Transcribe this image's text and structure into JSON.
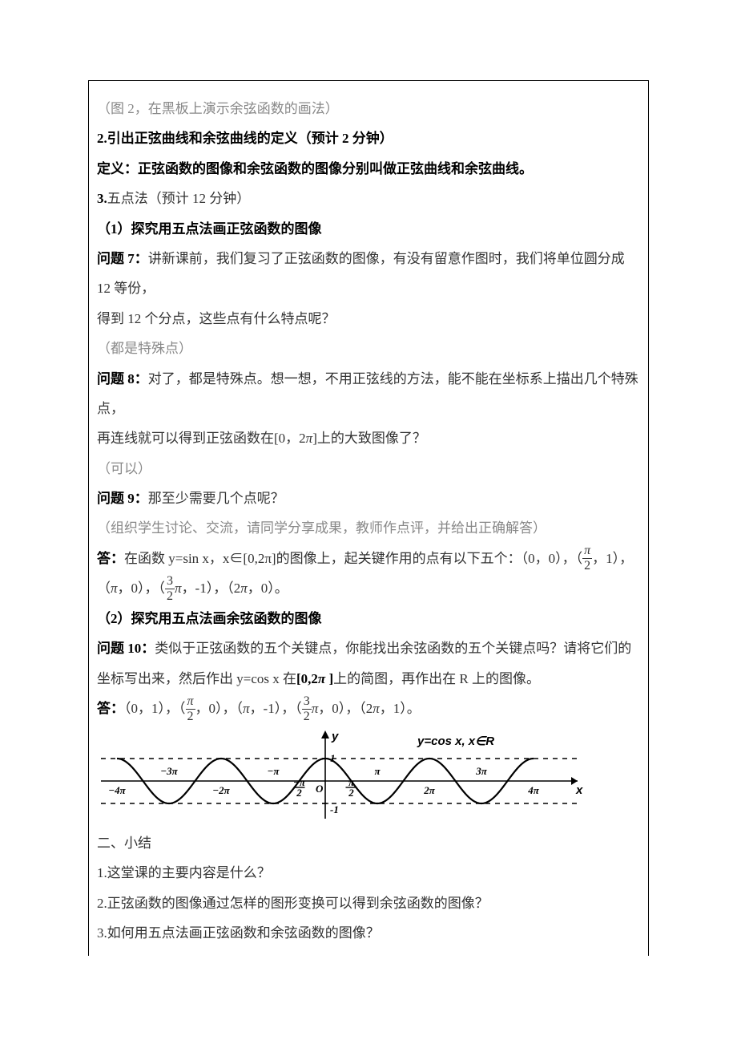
{
  "lines": {
    "l1": "（图 2，在黑板上演示余弦函数的画法）",
    "l2a": "2.",
    "l2b": "引出正弦曲线和余弦曲线的定义（预计 2 分钟）",
    "l3": "定义：正弦函数的图像和余弦函数的图像分别叫做正弦曲线和余弦曲线。",
    "l4a": "3.",
    "l4b": "五点法（预计 12 分钟）",
    "l5": "（1）探究用五点法画正弦函数的图像",
    "l6a": "问题 7：",
    "l6b": "讲新课前，我们复习了正弦函数的图像，有没有留意作图时，我们将单位圆分成 12 等份，",
    "l7": "得到 12 个分点，这些点有什么特点呢？",
    "l8": "（都是特殊点）",
    "l9a": "问题 8：",
    "l9b": "对了，都是特殊点。想一想，不用正弦线的方法，能不能在坐标系上描出几个特殊点，",
    "l10a": "再连线就可以得到正弦函数在[0，",
    "l10b": "]上的大致图像了？",
    "l11": "（可以）",
    "l12a": "问题 9：",
    "l12b": "那至少需要几个点呢？",
    "l13": "（组织学生讨论、交流，请同学分享成果，教师作点评，并给出正确解答）",
    "l14a": "答：",
    "l14b": "在函数 y=sin x，x∈[0,2π]的图像上，起关键作用的点有以下五个：（0，0），（",
    "l14c": "，1），",
    "l15a": "（",
    "l15b": "，0），（",
    "l15c": "，-1），（",
    "l15d": "，0）。",
    "l16": "（2）探究用五点法画余弦函数的图像",
    "l17a": "问题 10：",
    "l17b": "类似于正弦函数的五个关键点，你能找出余弦函数的五个关键点吗？请将它们的坐标写出来，然后作出 y=cos x 在",
    "l17c": "[0,2",
    "l17d": " ]",
    "l17e": "上的简图，再作出在 R 上的图像。",
    "l18a": "答：",
    "l18b": "（0，1），（",
    "l18c": "，0），（",
    "l18d": "，-1），（",
    "l18e": "，0），（",
    "l18f": "，1）。",
    "s1": "二、小结",
    "s2": "1.这堂课的主要内容是什么？",
    "s3": "2.正弦函数的图像通过怎样的图形变换可以得到余弦函数的图像？",
    "s4": "3.如何用五点法画正弦函数和余弦函数的图像？"
  },
  "fractions": {
    "piOver2": {
      "num": "π",
      "den": "2"
    },
    "threePiOver2": {
      "num": "3",
      "den": "2"
    }
  },
  "symbols": {
    "pi": "π",
    "twoPi": "2π"
  },
  "chart_data": {
    "type": "line",
    "title": "y=cos x, x∈R",
    "xlabel": "x",
    "ylabel": "y",
    "x_range_pi": [
      -4,
      4
    ],
    "ylim": [
      -1,
      1
    ],
    "function": "cos(x)",
    "x_ticks_pi": [
      -4,
      -3,
      -2,
      -1,
      -0.5,
      0,
      0.5,
      1,
      2,
      3,
      4
    ],
    "x_tick_labels": [
      "-4π",
      "-3π",
      "-2π",
      "-π",
      "-π/2",
      "O",
      "π/2",
      "π",
      "2π",
      "3π",
      "4π"
    ],
    "y_ticks": [
      -1,
      1
    ],
    "guides_y": [
      -1,
      1
    ],
    "key_points": [
      [
        0,
        1
      ],
      [
        1.5708,
        0
      ],
      [
        3.1416,
        -1
      ],
      [
        4.7124,
        0
      ],
      [
        6.2832,
        1
      ]
    ],
    "origin_label": "O",
    "axis_labels": {
      "x": "x",
      "y": "y"
    },
    "legend_label": "y=cos x, x∈R"
  }
}
